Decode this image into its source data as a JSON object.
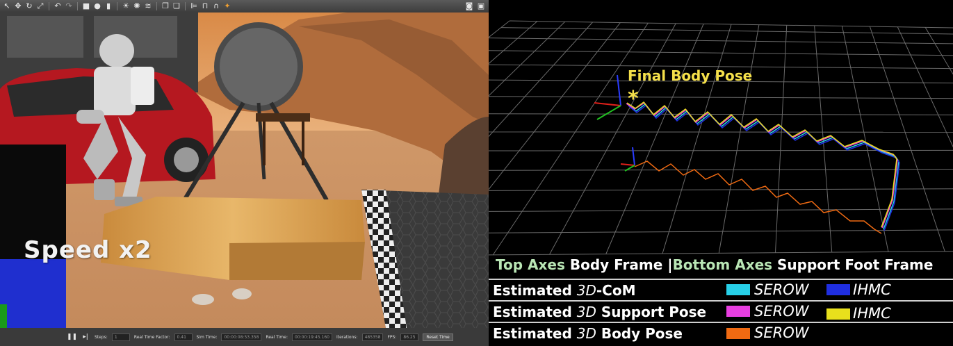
{
  "simulator": {
    "overlay_label": "Speed x2",
    "toolbar_icons": [
      "select-arrow-icon",
      "move-icon",
      "rotate-icon",
      "scale-icon",
      "undo-icon",
      "redo-icon",
      "box-icon",
      "sphere-icon",
      "cylinder-icon",
      "sun-icon",
      "spot-light-icon",
      "dir-light-icon",
      "copy-icon",
      "paste-icon",
      "align-icon",
      "snap-icon",
      "joint-icon",
      "screenshot-icon",
      "record-icon"
    ],
    "statusbar": {
      "steps_label": "Steps:",
      "steps_value": "1",
      "real_time_factor_label": "Real Time Factor:",
      "real_time_factor_value": "0.41",
      "sim_time_label": "Sim Time:",
      "sim_time_value": "00:00:08:53.358",
      "real_time_label": "Real Time:",
      "real_time_value": "00:00:19:45.160",
      "iterations_label": "Iterations:",
      "iterations_value": "485358",
      "fps_label": "FPS:",
      "fps_value": "86.25",
      "reset_button": "Reset Time"
    }
  },
  "visualization": {
    "final_body_pose_label": "Final Body Pose",
    "final_marker": "*",
    "frames_line": {
      "top_axes": "Top Axes",
      "body_frame": "Body Frame",
      "separator": "|",
      "bottom_axes": "Bottom Axes",
      "support_foot_frame": "Support Foot Frame"
    },
    "legend": [
      {
        "prefix": "Estimated ",
        "dim": "3D",
        "suffix": "-CoM",
        "entries": [
          {
            "name": "SEROW",
            "color": "#27d0e8"
          },
          {
            "name": "IHMC",
            "color": "#1f2ee0"
          }
        ]
      },
      {
        "prefix": "Estimated ",
        "dim": "3D",
        "suffix": " Support Pose",
        "entries": [
          {
            "name": "SEROW",
            "color": "#e83ee0"
          },
          {
            "name": "IHMC",
            "color": "#e8e01c"
          }
        ]
      },
      {
        "prefix": "Estimated ",
        "dim": "3D",
        "suffix": " Body Pose",
        "entries": [
          {
            "name": "SEROW",
            "color": "#f06a12"
          }
        ]
      }
    ]
  }
}
